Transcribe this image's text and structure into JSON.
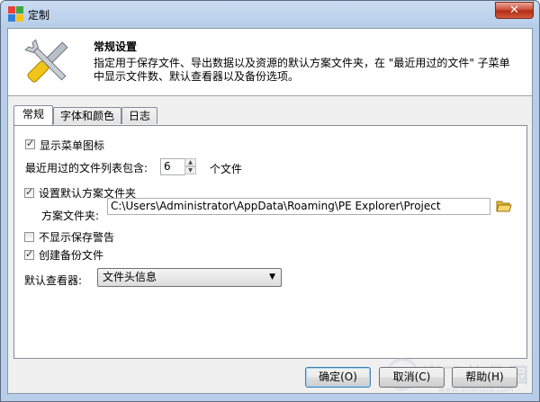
{
  "window": {
    "title": "定制",
    "close_glyph": "✕"
  },
  "header": {
    "title": "常规设置",
    "description": "指定用于保存文件、导出数据以及资源的默认方案文件夹，在 \"最近用过的文件\" 子菜单中显示文件数、默认查看器以及备份选项。",
    "icon": "wrench-screwdriver-icon"
  },
  "tabs": [
    {
      "label": "常规",
      "active": true
    },
    {
      "label": "字体和颜色",
      "active": false
    },
    {
      "label": "日志",
      "active": false
    }
  ],
  "general": {
    "show_menu_icons": {
      "label": "显示菜单图标",
      "checked": true
    },
    "recent_files": {
      "label": "最近用过的文件列表包含:",
      "value": "6",
      "suffix": "个文件"
    },
    "set_default_folder": {
      "label": "设置默认方案文件夹",
      "checked": true
    },
    "project_folder": {
      "label": "方案文件夹:",
      "value": "C:\\Users\\Administrator\\AppData\\Roaming\\PE Explorer\\Project"
    },
    "no_save_warning": {
      "label": "不显示保存警告",
      "checked": false
    },
    "create_backup": {
      "label": "创建备份文件",
      "checked": true
    },
    "default_viewer": {
      "label": "默认查看器:",
      "selected": "文件头信息"
    }
  },
  "buttons": {
    "ok": "确定(O)",
    "cancel": "取消(C)",
    "help": "帮助(H)"
  },
  "watermark": {
    "text": "当下软件园",
    "url": "www.downxia.com"
  },
  "colors": {
    "title_bar": "#b7cde8",
    "close_button": "#c8452e",
    "default_button_border": "#3c7fb1"
  }
}
